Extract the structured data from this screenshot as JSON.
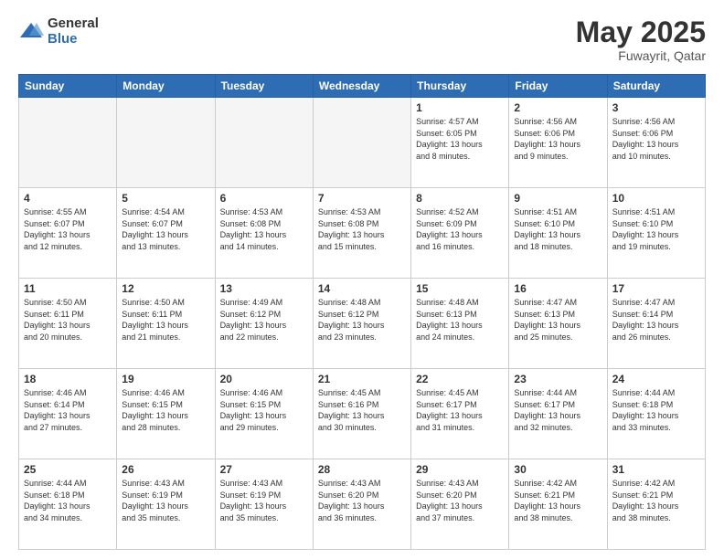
{
  "header": {
    "logo_general": "General",
    "logo_blue": "Blue",
    "title": "May 2025",
    "location": "Fuwayrit, Qatar"
  },
  "days_of_week": [
    "Sunday",
    "Monday",
    "Tuesday",
    "Wednesday",
    "Thursday",
    "Friday",
    "Saturday"
  ],
  "weeks": [
    [
      {
        "day": "",
        "info": ""
      },
      {
        "day": "",
        "info": ""
      },
      {
        "day": "",
        "info": ""
      },
      {
        "day": "",
        "info": ""
      },
      {
        "day": "1",
        "info": "Sunrise: 4:57 AM\nSunset: 6:05 PM\nDaylight: 13 hours\nand 8 minutes."
      },
      {
        "day": "2",
        "info": "Sunrise: 4:56 AM\nSunset: 6:06 PM\nDaylight: 13 hours\nand 9 minutes."
      },
      {
        "day": "3",
        "info": "Sunrise: 4:56 AM\nSunset: 6:06 PM\nDaylight: 13 hours\nand 10 minutes."
      }
    ],
    [
      {
        "day": "4",
        "info": "Sunrise: 4:55 AM\nSunset: 6:07 PM\nDaylight: 13 hours\nand 12 minutes."
      },
      {
        "day": "5",
        "info": "Sunrise: 4:54 AM\nSunset: 6:07 PM\nDaylight: 13 hours\nand 13 minutes."
      },
      {
        "day": "6",
        "info": "Sunrise: 4:53 AM\nSunset: 6:08 PM\nDaylight: 13 hours\nand 14 minutes."
      },
      {
        "day": "7",
        "info": "Sunrise: 4:53 AM\nSunset: 6:08 PM\nDaylight: 13 hours\nand 15 minutes."
      },
      {
        "day": "8",
        "info": "Sunrise: 4:52 AM\nSunset: 6:09 PM\nDaylight: 13 hours\nand 16 minutes."
      },
      {
        "day": "9",
        "info": "Sunrise: 4:51 AM\nSunset: 6:10 PM\nDaylight: 13 hours\nand 18 minutes."
      },
      {
        "day": "10",
        "info": "Sunrise: 4:51 AM\nSunset: 6:10 PM\nDaylight: 13 hours\nand 19 minutes."
      }
    ],
    [
      {
        "day": "11",
        "info": "Sunrise: 4:50 AM\nSunset: 6:11 PM\nDaylight: 13 hours\nand 20 minutes."
      },
      {
        "day": "12",
        "info": "Sunrise: 4:50 AM\nSunset: 6:11 PM\nDaylight: 13 hours\nand 21 minutes."
      },
      {
        "day": "13",
        "info": "Sunrise: 4:49 AM\nSunset: 6:12 PM\nDaylight: 13 hours\nand 22 minutes."
      },
      {
        "day": "14",
        "info": "Sunrise: 4:48 AM\nSunset: 6:12 PM\nDaylight: 13 hours\nand 23 minutes."
      },
      {
        "day": "15",
        "info": "Sunrise: 4:48 AM\nSunset: 6:13 PM\nDaylight: 13 hours\nand 24 minutes."
      },
      {
        "day": "16",
        "info": "Sunrise: 4:47 AM\nSunset: 6:13 PM\nDaylight: 13 hours\nand 25 minutes."
      },
      {
        "day": "17",
        "info": "Sunrise: 4:47 AM\nSunset: 6:14 PM\nDaylight: 13 hours\nand 26 minutes."
      }
    ],
    [
      {
        "day": "18",
        "info": "Sunrise: 4:46 AM\nSunset: 6:14 PM\nDaylight: 13 hours\nand 27 minutes."
      },
      {
        "day": "19",
        "info": "Sunrise: 4:46 AM\nSunset: 6:15 PM\nDaylight: 13 hours\nand 28 minutes."
      },
      {
        "day": "20",
        "info": "Sunrise: 4:46 AM\nSunset: 6:15 PM\nDaylight: 13 hours\nand 29 minutes."
      },
      {
        "day": "21",
        "info": "Sunrise: 4:45 AM\nSunset: 6:16 PM\nDaylight: 13 hours\nand 30 minutes."
      },
      {
        "day": "22",
        "info": "Sunrise: 4:45 AM\nSunset: 6:17 PM\nDaylight: 13 hours\nand 31 minutes."
      },
      {
        "day": "23",
        "info": "Sunrise: 4:44 AM\nSunset: 6:17 PM\nDaylight: 13 hours\nand 32 minutes."
      },
      {
        "day": "24",
        "info": "Sunrise: 4:44 AM\nSunset: 6:18 PM\nDaylight: 13 hours\nand 33 minutes."
      }
    ],
    [
      {
        "day": "25",
        "info": "Sunrise: 4:44 AM\nSunset: 6:18 PM\nDaylight: 13 hours\nand 34 minutes."
      },
      {
        "day": "26",
        "info": "Sunrise: 4:43 AM\nSunset: 6:19 PM\nDaylight: 13 hours\nand 35 minutes."
      },
      {
        "day": "27",
        "info": "Sunrise: 4:43 AM\nSunset: 6:19 PM\nDaylight: 13 hours\nand 35 minutes."
      },
      {
        "day": "28",
        "info": "Sunrise: 4:43 AM\nSunset: 6:20 PM\nDaylight: 13 hours\nand 36 minutes."
      },
      {
        "day": "29",
        "info": "Sunrise: 4:43 AM\nSunset: 6:20 PM\nDaylight: 13 hours\nand 37 minutes."
      },
      {
        "day": "30",
        "info": "Sunrise: 4:42 AM\nSunset: 6:21 PM\nDaylight: 13 hours\nand 38 minutes."
      },
      {
        "day": "31",
        "info": "Sunrise: 4:42 AM\nSunset: 6:21 PM\nDaylight: 13 hours\nand 38 minutes."
      }
    ]
  ]
}
